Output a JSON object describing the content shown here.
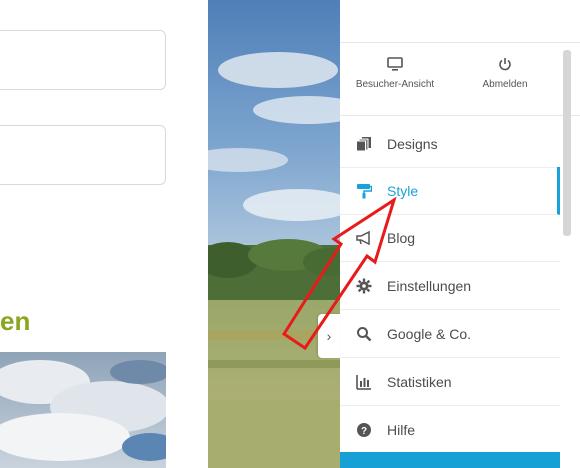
{
  "left": {
    "heading_fragment": "en"
  },
  "panel": {
    "top_buttons": [
      {
        "label": "Besucher-Ansicht",
        "icon": "monitor-icon"
      },
      {
        "label": "Abmelden",
        "icon": "power-icon"
      }
    ],
    "menu": [
      {
        "label": "Designs",
        "icon": "designs-icon",
        "active": false
      },
      {
        "label": "Style",
        "icon": "paint-roller-icon",
        "active": true
      },
      {
        "label": "Blog",
        "icon": "megaphone-icon",
        "active": false
      },
      {
        "label": "Einstellungen",
        "icon": "gear-icon",
        "active": false
      },
      {
        "label": "Google & Co.",
        "icon": "search-icon",
        "active": false
      },
      {
        "label": "Statistiken",
        "icon": "bar-chart-icon",
        "active": false
      },
      {
        "label": "Hilfe",
        "icon": "help-icon",
        "active": false
      }
    ]
  },
  "colors": {
    "accent": "#18a3d8",
    "heading_green": "#8aa51f",
    "annotation_arrow": "#e81a1a"
  },
  "collapse_toggle": {
    "glyph": "›"
  }
}
